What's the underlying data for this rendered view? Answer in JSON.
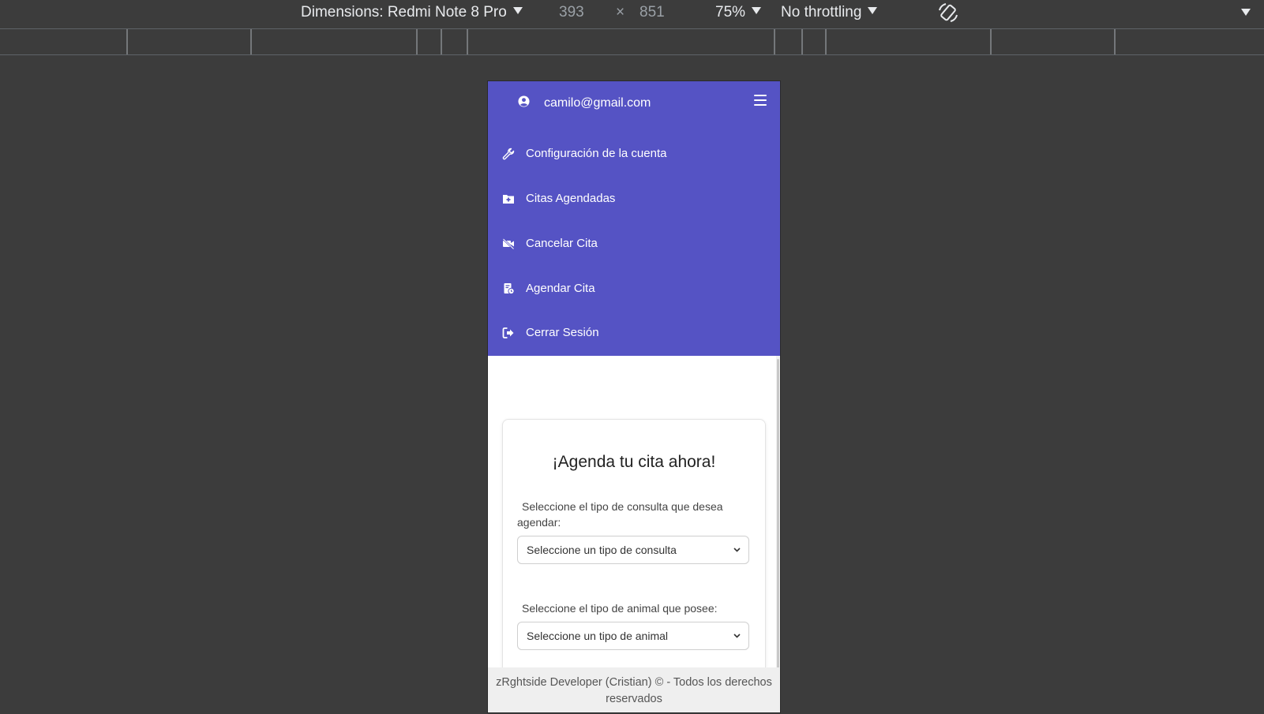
{
  "devtools": {
    "dimensions_label": "Dimensions: Redmi Note 8 Pro",
    "width": "393",
    "times": "×",
    "height": "851",
    "zoom": "75%",
    "throttling": "No throttling"
  },
  "header": {
    "user_email": "camilo@gmail.com",
    "accent_color": "#5553c4"
  },
  "menu": {
    "items": [
      {
        "label": "Configuración de la cuenta",
        "icon": "wrench-icon"
      },
      {
        "label": "Citas Agendadas",
        "icon": "folder-plus-icon"
      },
      {
        "label": "Cancelar Cita",
        "icon": "video-slash-icon"
      },
      {
        "label": "Agendar Cita",
        "icon": "file-clock-icon"
      },
      {
        "label": "Cerrar Sesión",
        "icon": "sign-out-icon"
      }
    ]
  },
  "form": {
    "title": "¡Agenda tu cita ahora!",
    "consulta_label": "Seleccione el tipo de consulta que desea agendar:",
    "consulta_selected": "Seleccione un tipo de consulta",
    "animal_label": "Seleccione el tipo de animal que posee:",
    "animal_selected": "Seleccione un tipo de animal"
  },
  "footer": {
    "text": "zRghtside Developer (Cristian) © - Todos los derechos reservados"
  }
}
